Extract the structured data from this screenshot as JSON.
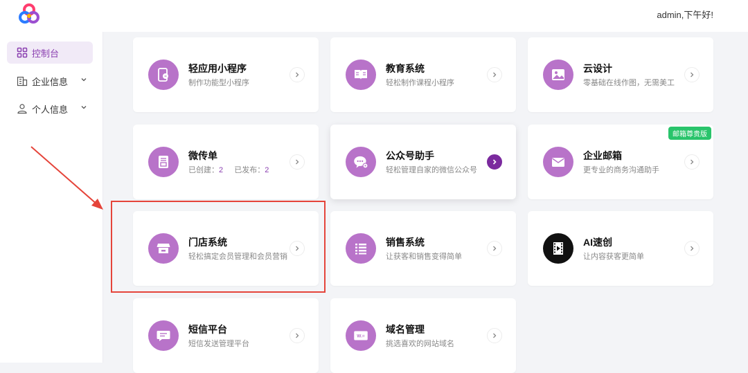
{
  "header": {
    "greeting": "admin,下午好!"
  },
  "sidebar": {
    "items": [
      {
        "label": "控制台",
        "icon": "dashboard-icon",
        "active": true
      },
      {
        "label": "企业信息",
        "icon": "building-icon",
        "expandable": true
      },
      {
        "label": "个人信息",
        "icon": "user-icon",
        "expandable": true
      }
    ]
  },
  "cards": [
    {
      "title": "轻应用小程序",
      "subtitle": "制作功能型小程序",
      "icon": "mini-program-icon"
    },
    {
      "title": "教育系统",
      "subtitle": "轻松制作课程小程序",
      "icon": "book-icon"
    },
    {
      "title": "云设计",
      "subtitle": "零基础在线作图，无需美工",
      "icon": "image-icon"
    },
    {
      "title": "微传单",
      "icon": "flyer-icon",
      "stats": {
        "created_label": "已创建：",
        "created": "2",
        "published_label": "已发布：",
        "published": "2"
      }
    },
    {
      "title": "公众号助手",
      "subtitle": "轻松管理自家的微信公众号",
      "icon": "wechat-icon"
    },
    {
      "title": "企业邮箱",
      "subtitle": "更专业的商务沟通助手",
      "icon": "mail-icon",
      "badge": "邮箱尊贵版"
    },
    {
      "title": "门店系统",
      "subtitle": "轻松搞定会员管理和会员营销",
      "icon": "store-icon"
    },
    {
      "title": "销售系统",
      "subtitle": "让获客和销售变得简单",
      "icon": "list-icon"
    },
    {
      "title": "AI速创",
      "subtitle": "让内容获客更简单",
      "icon": "video-icon"
    },
    {
      "title": "短信平台",
      "subtitle": "短信发送管理平台",
      "icon": "message-icon"
    },
    {
      "title": "域名管理",
      "subtitle": "挑选喜欢的网站域名",
      "icon": "domain-icon"
    }
  ],
  "colors": {
    "accent": "#8a3fb0",
    "icon_bg": "#b873c9",
    "badge": "#29c46b",
    "annotation": "#e5443a"
  }
}
